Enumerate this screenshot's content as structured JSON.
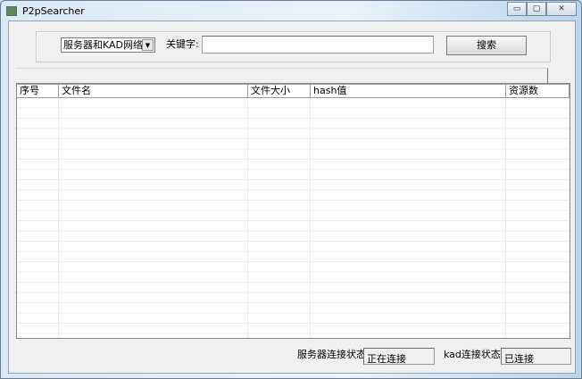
{
  "window": {
    "title": "P2pSearcher",
    "minimize": "▭",
    "maximize": "▢",
    "close": "✕"
  },
  "search": {
    "network_selected": "服务器和KAD网络",
    "keyword_label": "关键字:",
    "keyword_value": "",
    "search_button": "搜索"
  },
  "table": {
    "columns": [
      "序号",
      "文件名",
      "文件大小",
      "hash值",
      "资源数"
    ],
    "rows": []
  },
  "status": {
    "server_label": "服务器连接状态:",
    "server_value": "正在连接",
    "kad_label": "kad连接状态:",
    "kad_value": "已连接"
  }
}
